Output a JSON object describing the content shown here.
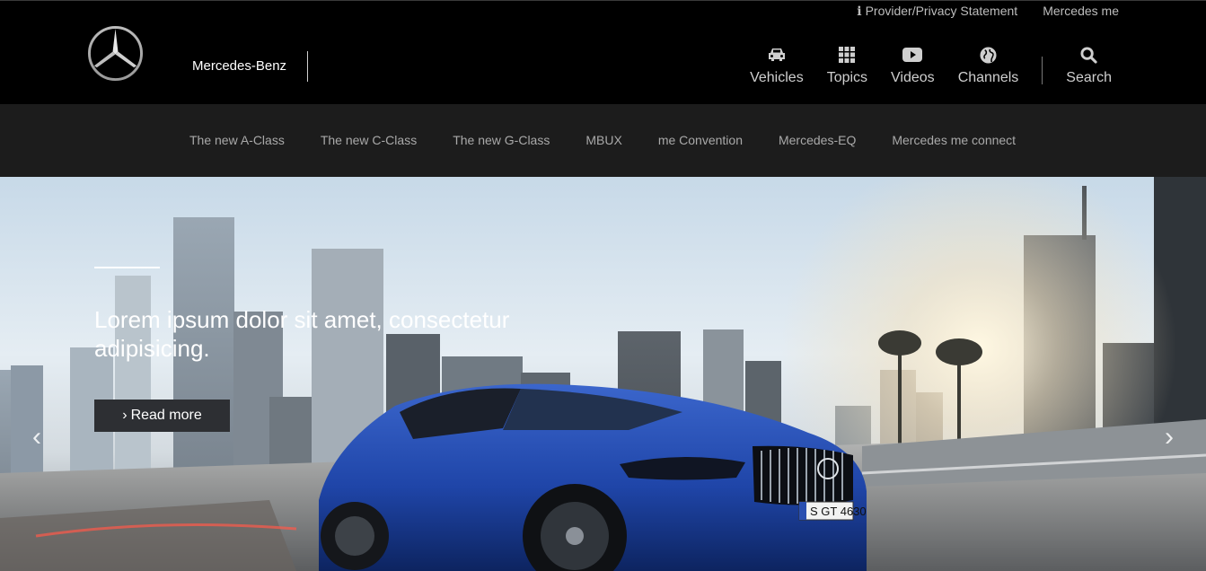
{
  "utility": {
    "provider_privacy": "Provider/Privacy Statement",
    "mercedes_me": "Mercedes me"
  },
  "brand": {
    "name": "Mercedes-Benz"
  },
  "main_nav": [
    {
      "label": "Vehicles",
      "icon": "car-icon"
    },
    {
      "label": "Topics",
      "icon": "grid-icon"
    },
    {
      "label": "Videos",
      "icon": "video-icon"
    },
    {
      "label": "Channels",
      "icon": "globe-icon"
    },
    {
      "label": "Search",
      "icon": "search-icon"
    }
  ],
  "sub_nav": [
    "The new A-Class",
    "The new C-Class",
    "The new G-Class",
    "MBUX",
    "me Convention",
    "Mercedes-EQ",
    "Mercedes me connect"
  ],
  "hero": {
    "title": "Lorem ipsum dolor sit amet, consectetur adipisicing.",
    "button": "Read more",
    "plate": "S GT 4630"
  },
  "colors": {
    "header_bg": "#000000",
    "subnav_bg": "#1c1c1c",
    "button_bg": "#2d2f33",
    "car_blue": "#1f45a8"
  }
}
